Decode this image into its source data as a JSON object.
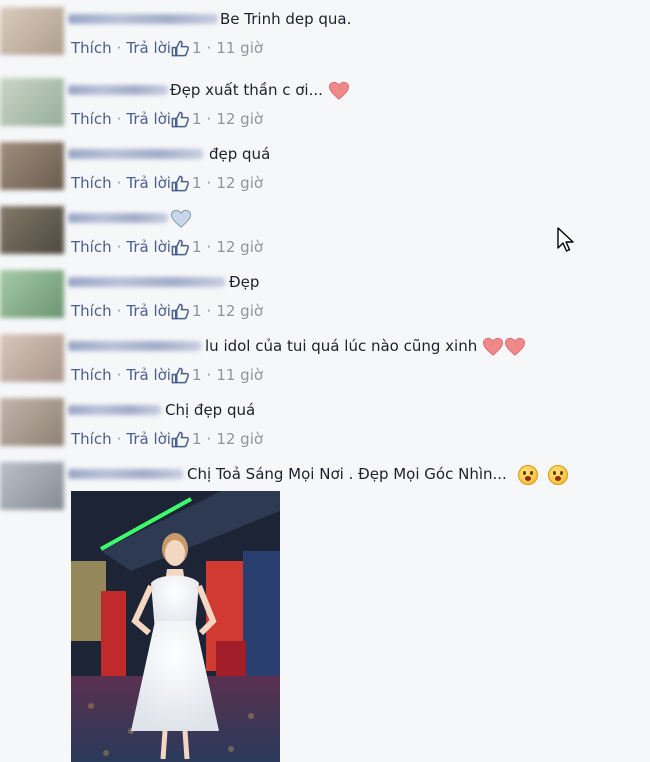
{
  "actions": {
    "like": "Thích",
    "reply": "Trả lời"
  },
  "comments": [
    {
      "text": "Be Trinh dep qua.",
      "likes": "1",
      "time": "11 giờ",
      "avatar_color": "#c9b8a6"
    },
    {
      "text": "Đẹp xuất thần c ơi...",
      "likes": "1",
      "time": "12 giờ",
      "avatar_color": "#b7c7b4"
    },
    {
      "text": "đẹp quá",
      "likes": "1",
      "time": "12 giờ",
      "avatar_color": "#8a7a66"
    },
    {
      "text": "",
      "likes": "1",
      "time": "12 giờ",
      "avatar_color": "#6b6252"
    },
    {
      "text": "Đẹp",
      "likes": "1",
      "time": "12 giờ",
      "avatar_color": "#7fae84"
    },
    {
      "text": "lu idol của tui quá lúc nào cũng xinh",
      "likes": "1",
      "time": "11 giờ",
      "avatar_color": "#c4b3a7"
    },
    {
      "text": "Chị đẹp quá",
      "likes": "1",
      "time": "12 giờ",
      "avatar_color": "#a89a8c"
    },
    {
      "text": "Chị Toả Sáng Mọi Nơi . Đẹp Mọi Góc Nhìn...",
      "likes": "",
      "time": "",
      "avatar_color": "#9aa0a8"
    }
  ],
  "colors": {
    "link": "#4b5f8c",
    "heart": "#f08a8a",
    "heart_blue": "#c8d6ea"
  }
}
